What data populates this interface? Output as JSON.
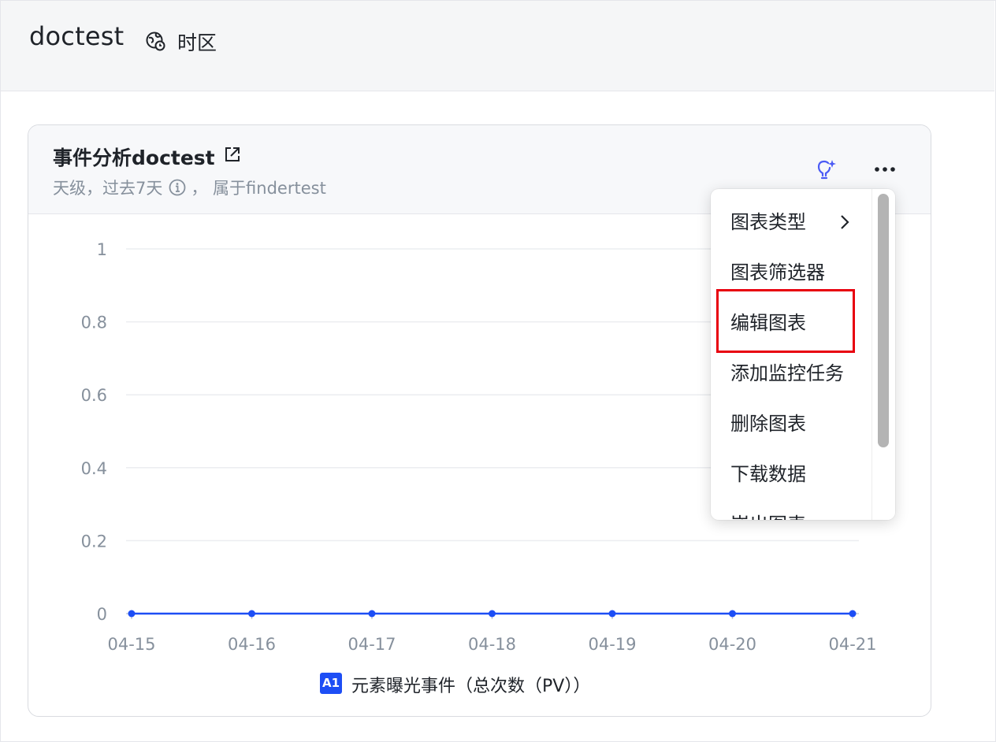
{
  "page": {
    "title": "doctest",
    "timezone_label": "时区"
  },
  "card": {
    "title": "事件分析doctest",
    "subtitle_left": "天级，过去7天",
    "subtitle_right": "，  属于findertest"
  },
  "menu": {
    "items": [
      {
        "label": "图表类型",
        "has_submenu": true
      },
      {
        "label": "图表筛选器"
      },
      {
        "label": "编辑图表",
        "highlighted": true
      },
      {
        "label": "添加监控任务"
      },
      {
        "label": "删除图表"
      },
      {
        "label": "下载数据"
      },
      {
        "label": "嵌出图表"
      }
    ]
  },
  "legend": {
    "badge": "A1",
    "label": "元素曝光事件（总次数（PV））",
    "color": "#1d4ef5"
  },
  "chart_data": {
    "type": "line",
    "x": [
      "04-15",
      "04-16",
      "04-17",
      "04-18",
      "04-19",
      "04-20",
      "04-21"
    ],
    "series": [
      {
        "name": "元素曝光事件（总次数（PV））",
        "values": [
          0,
          0,
          0,
          0,
          0,
          0,
          0
        ],
        "color": "#1d4ef5"
      }
    ],
    "yticks": [
      "1",
      "0.8",
      "0.6",
      "0.4",
      "0.2",
      "0"
    ],
    "ylim": [
      0,
      1
    ],
    "grid": true
  },
  "colors": {
    "accent": "#1d4ef5",
    "highlight_box": "#e8000e",
    "ai_icon": "#4b5bf5"
  }
}
